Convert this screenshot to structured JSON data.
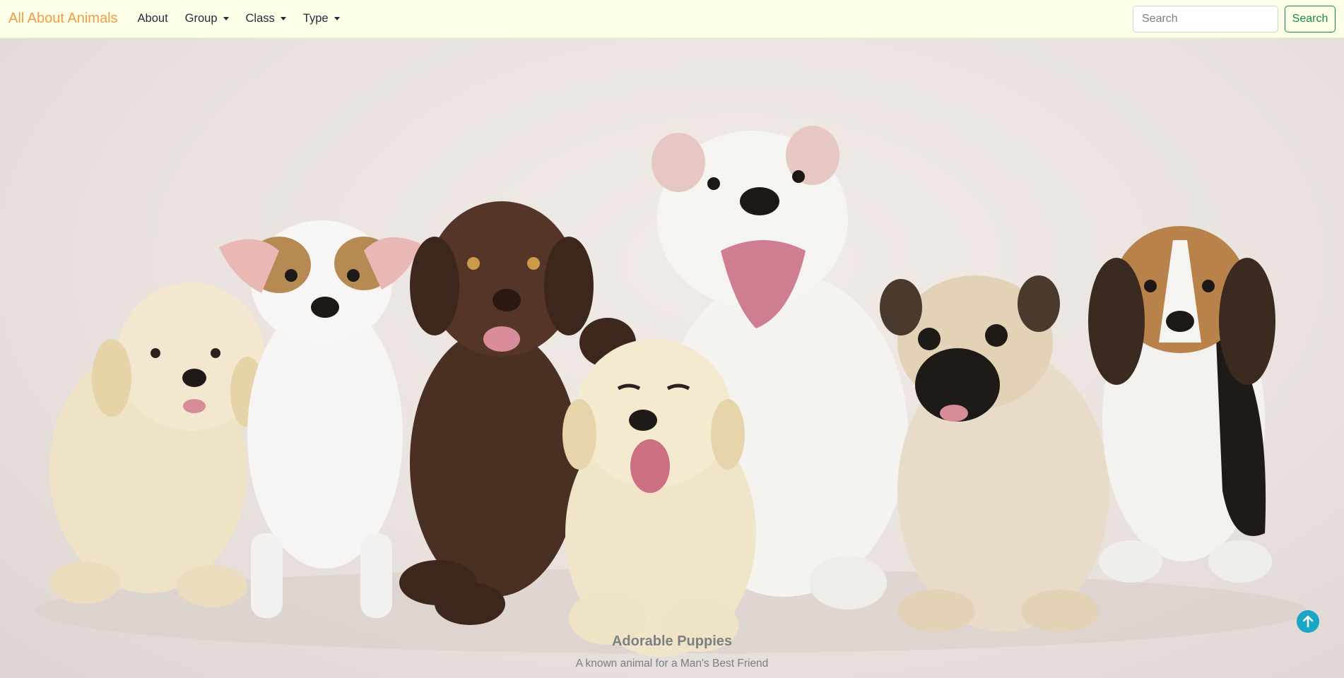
{
  "navbar": {
    "brand": "All About Animals",
    "links": [
      {
        "label": "About",
        "dropdown": false
      },
      {
        "label": "Group",
        "dropdown": true
      },
      {
        "label": "Class",
        "dropdown": true
      },
      {
        "label": "Type",
        "dropdown": true
      }
    ],
    "search": {
      "placeholder": "Search",
      "button_label": "Search"
    }
  },
  "hero": {
    "image_subject": "seven puppies sitting in a row",
    "caption_title": "Adorable Puppies",
    "caption_text": "A known animal for a Man's Best Friend"
  },
  "back_to_top": {
    "icon": "arrow-up-circle-icon"
  },
  "colors": {
    "navbar_bg": "#fdffe6",
    "brand": "#f2994a",
    "search_button": "#198754",
    "back_to_top": "#1aa6c7",
    "caption": "#7b7f86"
  }
}
